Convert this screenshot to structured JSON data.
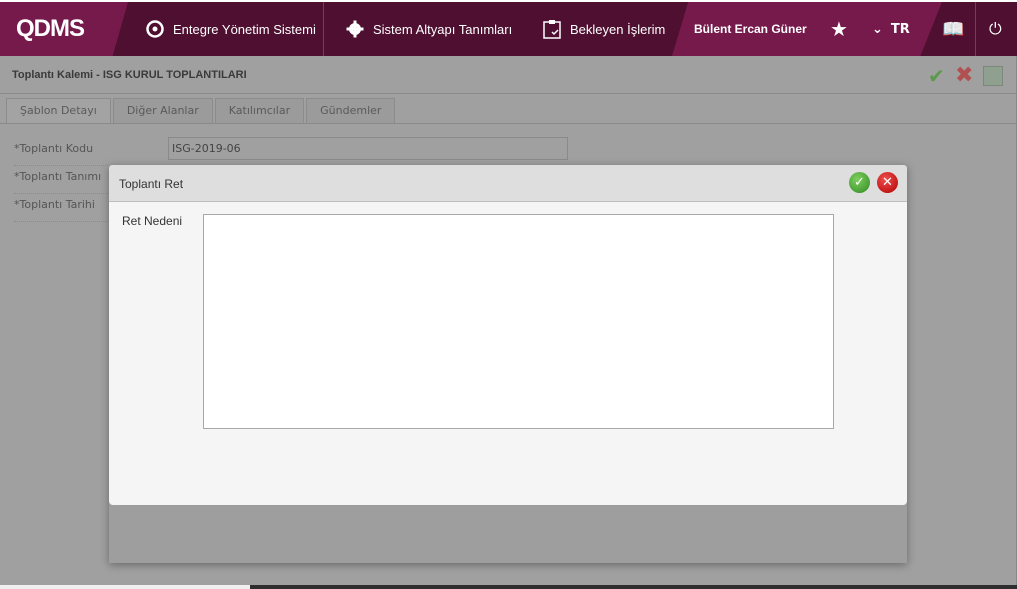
{
  "header": {
    "logo": "QDMS",
    "nav": [
      {
        "label": "Entegre Yönetim Sistemi"
      },
      {
        "label": "Sistem Altyapı Tanımları"
      },
      {
        "label": "Bekleyen İşlerim"
      }
    ],
    "user": "Bülent Ercan Güner",
    "language": "TR"
  },
  "page": {
    "title": "Toplantı Kalemi - ISG KURUL TOPLANTILARI",
    "tabs": [
      "Şablon Detayı",
      "Diğer Alanlar",
      "Katılımcılar",
      "Gündemler"
    ],
    "fields": [
      {
        "label": "*Toplantı Kodu",
        "value": "ISG-2019-06"
      },
      {
        "label": "*Toplantı Tanımı"
      },
      {
        "label": "*Toplantı Tarihi"
      }
    ]
  },
  "modal": {
    "title": "Toplantı Ret",
    "reason_label": "Ret Nedeni",
    "reason_value": ""
  },
  "colors": {
    "header": "#4e0f30",
    "accent": "#761a4b",
    "overlay": "#a0a0a0"
  }
}
